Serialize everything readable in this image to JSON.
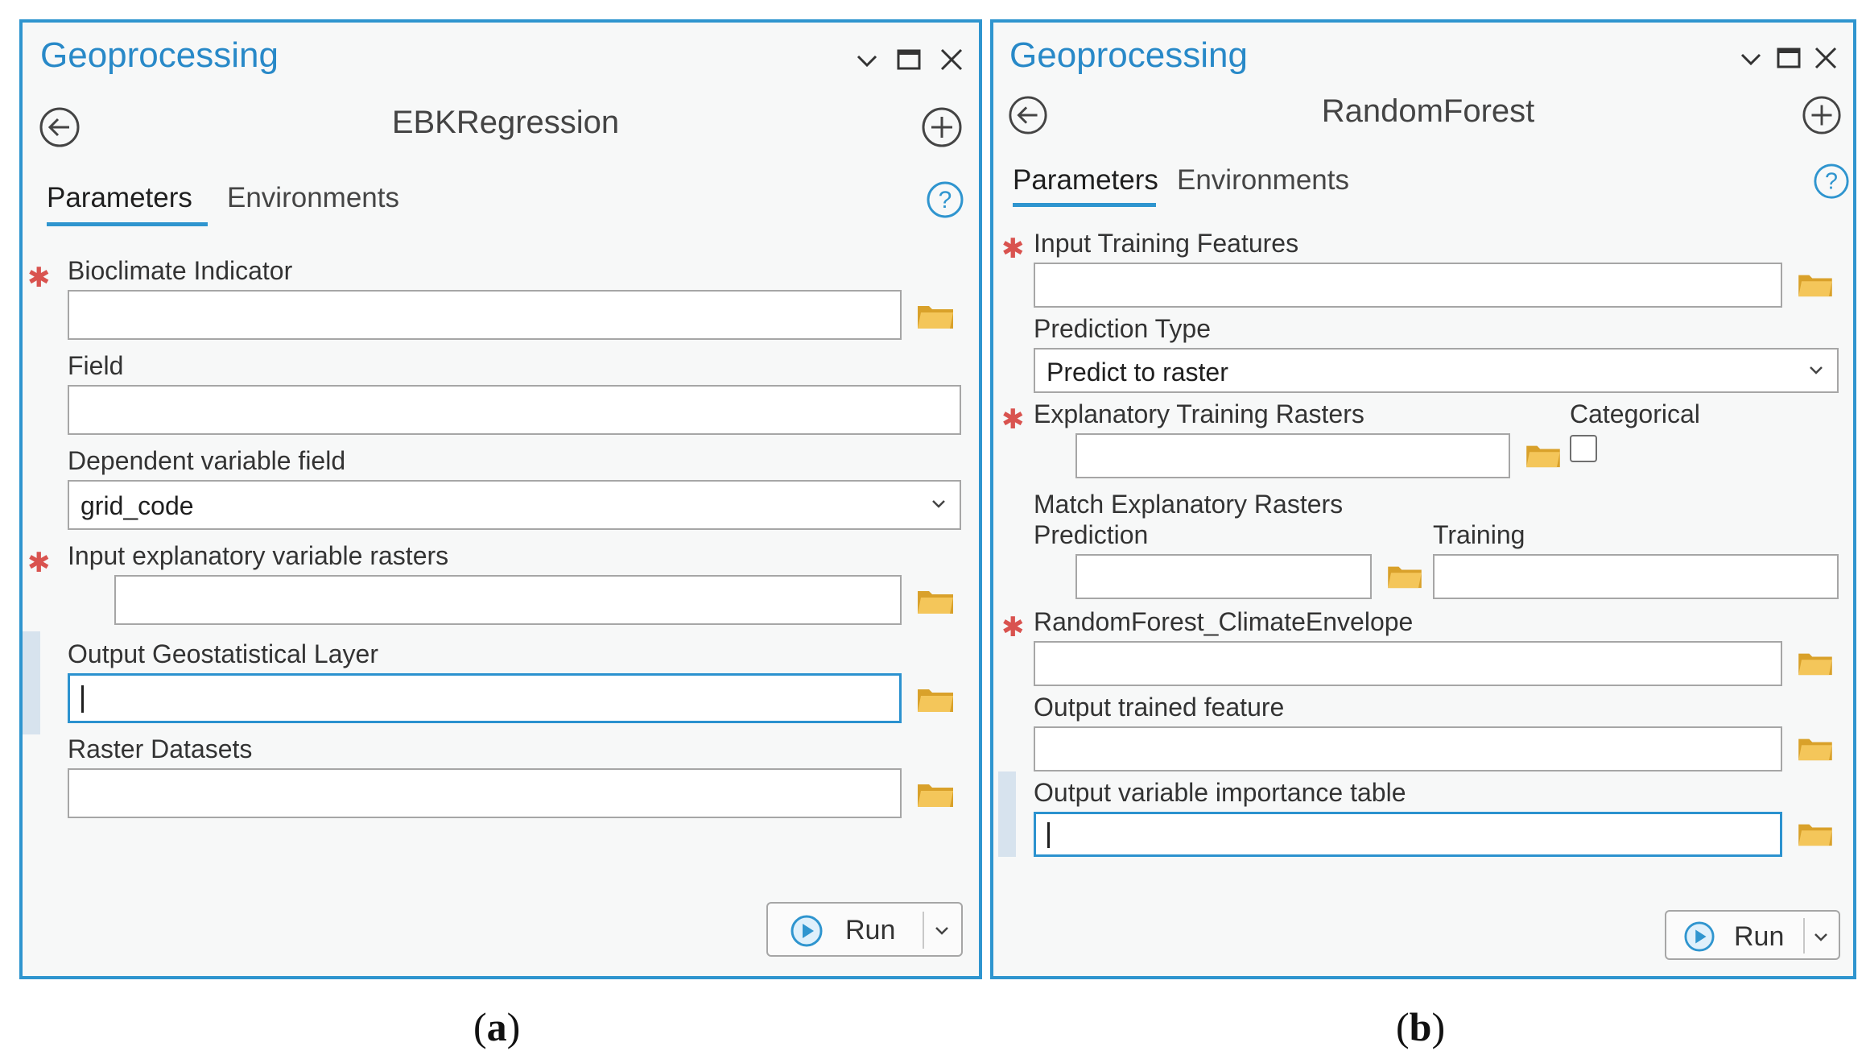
{
  "panel_a": {
    "title": "Geoprocessing",
    "tool_name": "EBKRegression",
    "tabs": [
      {
        "label": "Parameters"
      },
      {
        "label": "Environments"
      }
    ],
    "params": {
      "bioclimate_indicator": {
        "label": "Bioclimate Indicator",
        "value": ""
      },
      "field": {
        "label": "Field",
        "value": ""
      },
      "dependent_variable_field": {
        "label": "Dependent variable field",
        "value": "grid_code"
      },
      "input_explanatory_rasters": {
        "label": "Input explanatory variable rasters",
        "value": ""
      },
      "output_geostatistical_layer": {
        "label": "Output Geostatistical Layer",
        "value": ""
      },
      "raster_datasets": {
        "label": "Raster Datasets",
        "value": ""
      }
    },
    "run_label": "Run",
    "caption": {
      "open": "(",
      "letter": "a",
      "close": ")"
    }
  },
  "panel_b": {
    "title": "Geoprocessing",
    "tool_name": "RandomForest",
    "tabs": [
      {
        "label": "Parameters"
      },
      {
        "label": "Environments"
      }
    ],
    "params": {
      "input_training_features": {
        "label": "Input Training Features",
        "value": ""
      },
      "prediction_type": {
        "label": "Prediction Type",
        "value": "Predict to raster"
      },
      "explanatory_training_rasters": {
        "label": "Explanatory Training Rasters",
        "value": ""
      },
      "categorical": {
        "label": "Categorical",
        "checked": false
      },
      "match_explanatory_rasters": {
        "label": "Match Explanatory Rasters",
        "prediction_label": "Prediction",
        "training_label": "Training"
      },
      "climate_envelope": {
        "label": "RandomForest_ClimateEnvelope",
        "value": ""
      },
      "output_trained_feature": {
        "label": "Output trained feature",
        "value": ""
      },
      "output_variable_importance_table": {
        "label": "Output variable importance table",
        "value": ""
      }
    },
    "run_label": "Run",
    "caption": {
      "open": "(",
      "letter": "b",
      "close": ")"
    }
  },
  "colors": {
    "accent": "#2f95cf",
    "required": "#d9534f",
    "folder": "#e8b33b"
  },
  "icons": [
    "back-icon",
    "add-icon",
    "help-icon",
    "folder-icon",
    "chevron-down-icon",
    "maximize-icon",
    "close-icon",
    "run-icon"
  ]
}
